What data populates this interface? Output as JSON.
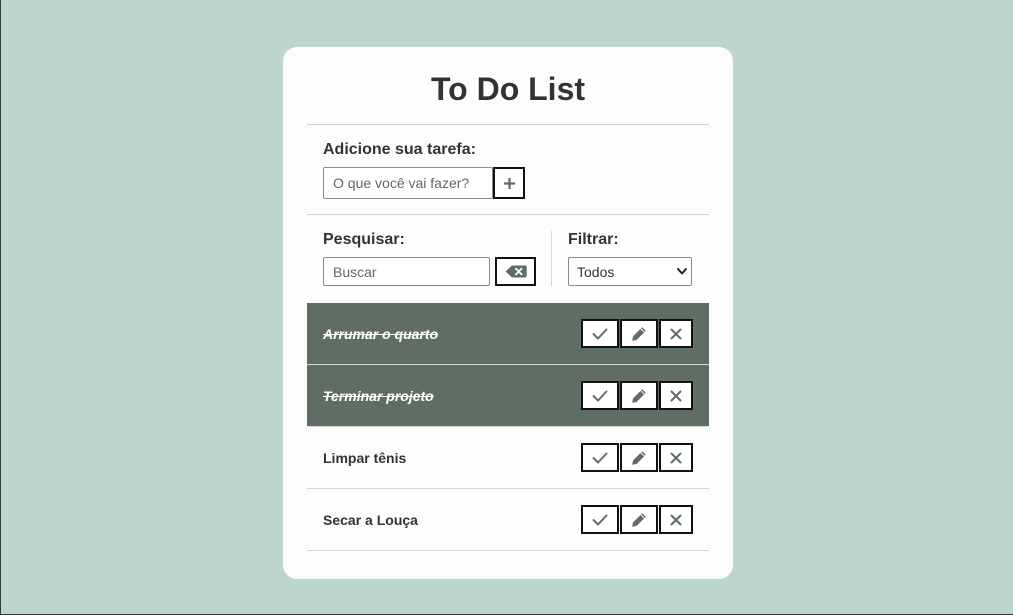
{
  "app": {
    "title": "To Do List"
  },
  "add": {
    "label": "Adicione sua tarefa:",
    "placeholder": "O que você vai fazer?",
    "value": "",
    "button_icon": "plus-icon"
  },
  "search": {
    "label": "Pesquisar:",
    "placeholder": "Buscar",
    "value": "",
    "erase_icon": "backspace-icon"
  },
  "filter": {
    "label": "Filtrar:",
    "selected": "Todos",
    "options": [
      "Todos"
    ]
  },
  "todos": [
    {
      "text": "Arrumar o quarto",
      "done": true
    },
    {
      "text": "Terminar projeto",
      "done": true
    },
    {
      "text": "Limpar tênis",
      "done": false
    },
    {
      "text": "Secar a Louça",
      "done": false
    }
  ],
  "todo_action_icons": [
    "check-icon",
    "pencil-icon",
    "close-icon"
  ],
  "colors": {
    "background": "#bdd5ce",
    "card": "#fdfdfd",
    "done_row": "#5f6e65",
    "accent_icon": "#5f6e65",
    "text": "#333333"
  }
}
